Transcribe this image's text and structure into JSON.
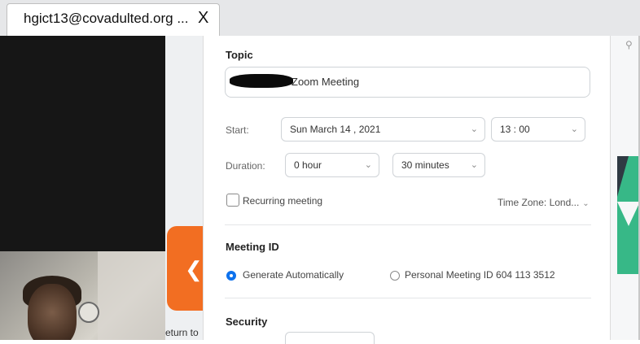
{
  "browser": {
    "tab_title": "hgict13@covadulted.org ...",
    "tab_close": "X"
  },
  "meeting_panel": {
    "return_text": "eturn to"
  },
  "schedule": {
    "topic_label": "Topic",
    "topic_value": "Zoom Meeting",
    "start_label": "Start:",
    "start_date": "Sun  March  14 ,  2021",
    "start_time": "13 : 00",
    "duration_label": "Duration:",
    "duration_hours": "0 hour",
    "duration_minutes": "30 minutes",
    "recurring_label": "Recurring meeting",
    "timezone": "Time Zone: Lond...",
    "meeting_id_label": "Meeting ID",
    "generate_auto": "Generate Automatically",
    "personal_id": "Personal Meeting ID 604 113 3512",
    "security_label": "Security",
    "selected_meeting_id_option": "Generate Automatically"
  },
  "colors": {
    "accent_blue": "#0e72ed",
    "orange": "#f26e22",
    "green": "#37b887"
  },
  "icons": {
    "dropdown": "chevron-down-icon",
    "back": "arrow-left-icon",
    "search": "search-icon"
  }
}
